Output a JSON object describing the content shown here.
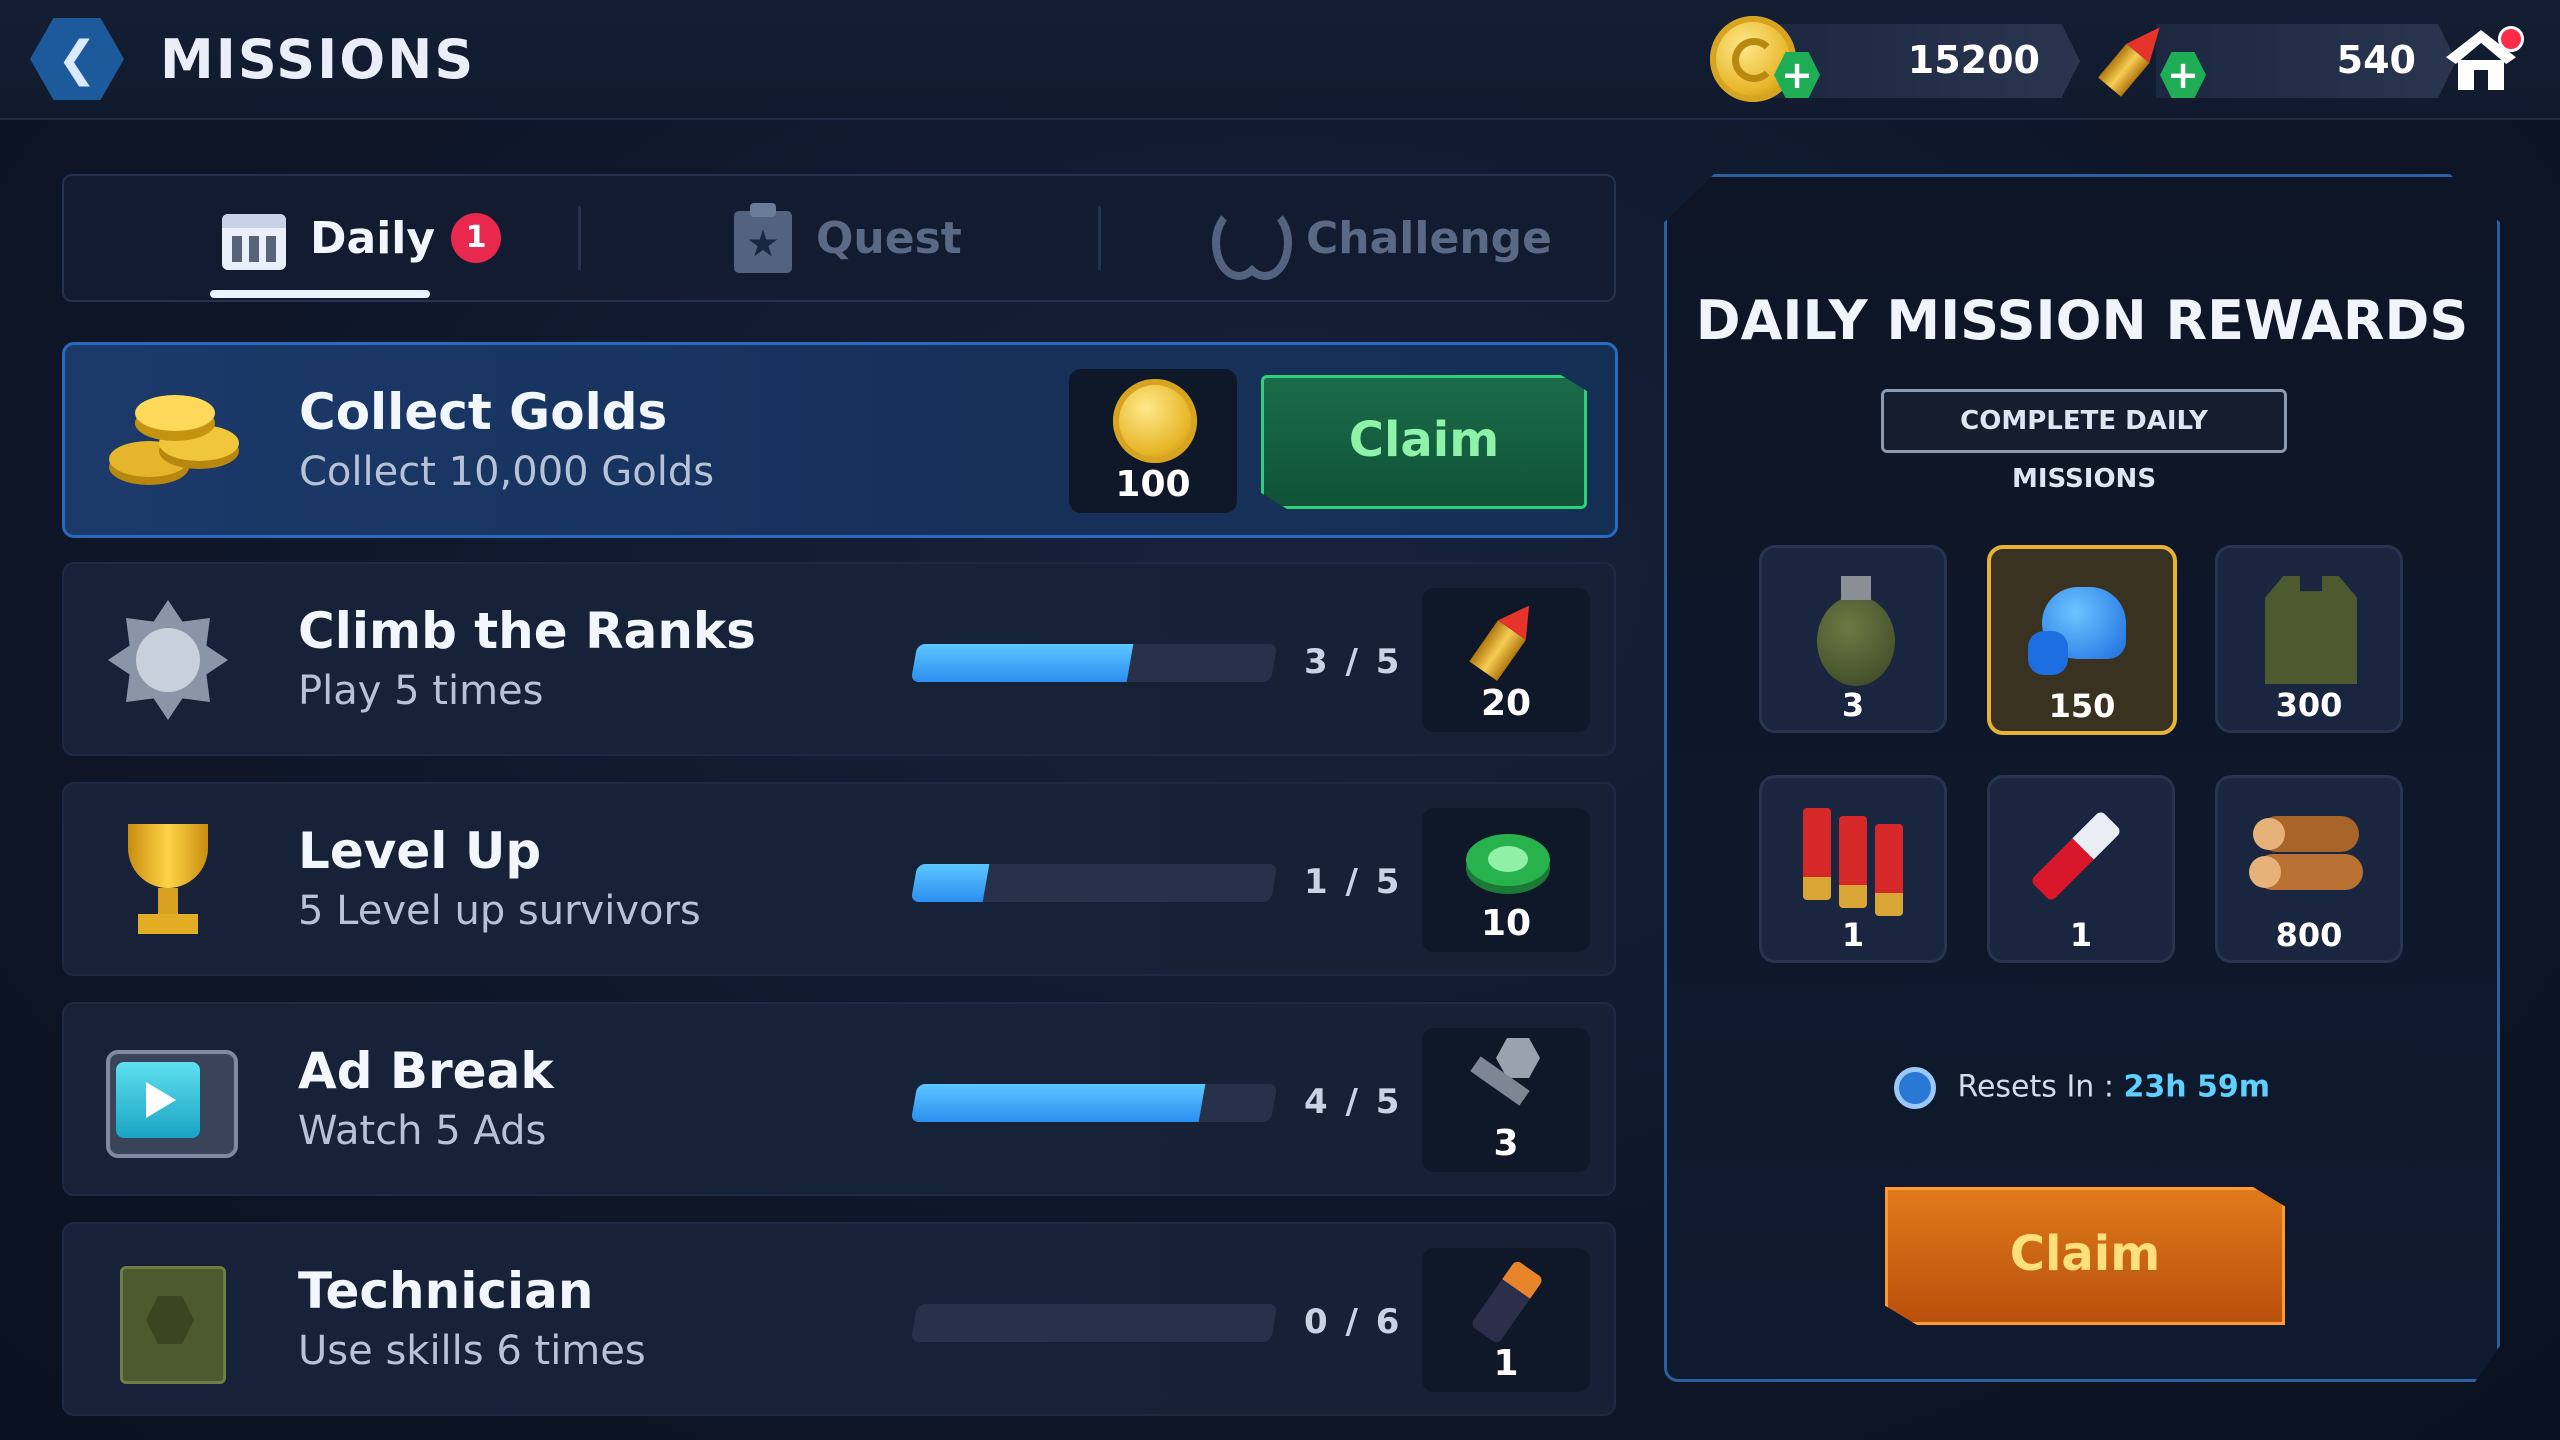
{
  "header": {
    "title": "MISSIONS",
    "back_glyph": "❮"
  },
  "currencies": [
    {
      "icon": "gold-coin-icon",
      "value": "15200"
    },
    {
      "icon": "bullet-icon",
      "value": "540"
    }
  ],
  "tabs": [
    {
      "label": "Daily",
      "badge": "1",
      "icon": "calendar-icon",
      "active": true
    },
    {
      "label": "Quest",
      "icon": "clipboard-star-icon",
      "active": false
    },
    {
      "label": "Challenge",
      "icon": "laurel-icon",
      "active": false
    }
  ],
  "missions": [
    {
      "title": "Collect Golds",
      "desc": "Collect 10,000 Golds",
      "icon": "gold-coins-stack-icon",
      "reward_icon": "gold-coin-icon",
      "reward": "100",
      "claim_label": "Claim",
      "completed": true
    },
    {
      "title": "Climb the Ranks",
      "desc": "Play 5 times",
      "icon": "rank-emblem-icon",
      "progress": "3 / 5",
      "fraction": 0.6,
      "reward_icon": "bullet-icon",
      "reward": "20"
    },
    {
      "title": "Level Up",
      "desc": "5 Level up survivors",
      "icon": "trophy-icon",
      "progress": "1 / 5",
      "fraction": 0.2,
      "reward_icon": "bottle-cap-icon",
      "reward": "10"
    },
    {
      "title": "Ad Break",
      "desc": "Watch 5 Ads",
      "icon": "tv-icon",
      "progress": "4 / 5",
      "fraction": 0.8,
      "reward_icon": "bolt-nut-icon",
      "reward": "3"
    },
    {
      "title": "Technician",
      "desc": "Use skills 6 times",
      "icon": "skill-book-icon",
      "progress": "0 / 6",
      "fraction": 0,
      "reward_icon": "battery-icon",
      "reward": "1"
    }
  ],
  "reward_panel": {
    "title": "DAILY MISSION REWARDS",
    "subtitle": "COMPLETE DAILY MISSIONS",
    "items": [
      {
        "icon": "grenade-icon",
        "amount": "3"
      },
      {
        "icon": "muscle-arm-icon",
        "amount": "150",
        "highlighted": true
      },
      {
        "icon": "armor-vest-icon",
        "amount": "300"
      },
      {
        "icon": "shotgun-shells-icon",
        "amount": "1"
      },
      {
        "icon": "syringe-icon",
        "amount": "1"
      },
      {
        "icon": "wood-logs-icon",
        "amount": "800"
      }
    ],
    "reset_label": "Resets In :",
    "reset_time": "23h 59m",
    "claim_label": "Claim"
  },
  "colors": {
    "accent_blue": "#2b69c2",
    "claim_green": "#2fd07a",
    "claim_orange": "#e07a1a",
    "badge_red": "#e8284c"
  }
}
